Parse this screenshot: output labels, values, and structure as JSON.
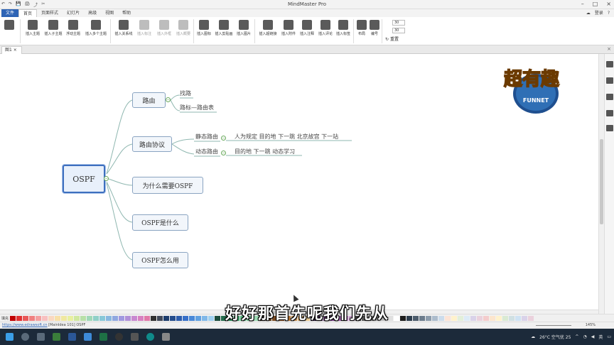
{
  "app": {
    "title": "MindMaster Pro",
    "quick_access": [
      "↶",
      "↷",
      "💾",
      "🖨",
      "⤴",
      "✂"
    ]
  },
  "menu": {
    "items": [
      "文件",
      "首页",
      "页面样式",
      "幻灯片",
      "高级",
      "视图",
      "帮助"
    ],
    "right": [
      "登录",
      "?"
    ]
  },
  "ribbon": {
    "buttons": [
      {
        "label": "插入主题",
        "disabled": false
      },
      {
        "label": "插入子主题",
        "disabled": false
      },
      {
        "label": "浮动主题",
        "disabled": false
      },
      {
        "label": "插入多个主题",
        "disabled": false
      },
      {
        "label": "插入关系线",
        "disabled": false
      },
      {
        "label": "插入标注",
        "disabled": true
      },
      {
        "label": "插入外框",
        "disabled": true
      },
      {
        "label": "插入概要",
        "disabled": true
      },
      {
        "label": "插入图标",
        "disabled": false
      },
      {
        "label": "插入剪贴画",
        "disabled": false
      },
      {
        "label": "插入图片",
        "disabled": false
      },
      {
        "label": "插入超链接",
        "disabled": false
      },
      {
        "label": "插入附件",
        "disabled": false
      },
      {
        "label": "插入注释",
        "disabled": false
      },
      {
        "label": "插入评论",
        "disabled": false
      },
      {
        "label": "插入标签",
        "disabled": false
      },
      {
        "label": "布局",
        "disabled": false
      },
      {
        "label": "编号",
        "disabled": false
      }
    ],
    "spin1": "30",
    "spin2": "30",
    "reset_label": "重置"
  },
  "tab": {
    "name": "图1"
  },
  "mindmap": {
    "root": "OSPF",
    "branches": [
      {
        "label": "路由",
        "children": [
          "找路",
          "路标—路由表"
        ]
      },
      {
        "label": "路由协议",
        "children": [
          {
            "label": "静态路由",
            "children": [
              "人为规定  目的地  下一跳   北京故宫  下一站"
            ]
          },
          {
            "label": "动态路由",
            "children": [
              "目的地  下一跳  动态学习"
            ]
          }
        ]
      },
      {
        "label": "为什么需要OSPF"
      },
      {
        "label": "OSPF是什么"
      },
      {
        "label": "OSPF怎么用"
      }
    ]
  },
  "logo": {
    "main": "超有趣",
    "sub": "FUNNET"
  },
  "palette": {
    "label": "填充",
    "colors": [
      "#c00000",
      "#e03030",
      "#e85858",
      "#f08080",
      "#f4a0a0",
      "#f8c0c0",
      "#fad8c0",
      "#f8e0a8",
      "#f0e8a0",
      "#e8f0a0",
      "#d0e8a0",
      "#b8e0a8",
      "#a0d8b8",
      "#90d0c8",
      "#88c8d8",
      "#88b8e0",
      "#90a8e0",
      "#a098e0",
      "#b090d8",
      "#c888d0",
      "#d880c0",
      "#e078a8",
      "#303030",
      "#404858",
      "#1c3c6c",
      "#244c8c",
      "#2c5cac",
      "#3870c8",
      "#4888d8",
      "#60a0e0",
      "#80b8e8",
      "#a0d0f0",
      "#1c4c3c",
      "#246c4c",
      "#2c8c5c",
      "#40a870",
      "#60c088",
      "#80d0a0",
      "#a0e0b8",
      "#3c2c1c",
      "#5c3c1c",
      "#7c4c24",
      "#9c5c2c",
      "#bc7c3c",
      "#d09858",
      "#e0b478",
      "#f0d098",
      "#2c1c3c",
      "#4c2c5c",
      "#6c3c7c",
      "#8c4c9c",
      "#ac68b8",
      "#c488cc",
      "#d8a8dc",
      "#404040",
      "#606060",
      "#808080",
      "#a0a0a0",
      "#c0c0c0",
      "#e0e0e0",
      "#ffffff",
      "#1c1c1c",
      "#2c3c4c",
      "#4c5c6c",
      "#6c7c8c",
      "#8c9cac",
      "#acbccc",
      "#ccdcec",
      "#fce4d6",
      "#fff2cc",
      "#e2efda",
      "#ddebf7",
      "#d9d2e9",
      "#ead1dc",
      "#f4cccc",
      "#fce5cd",
      "#fff2cc",
      "#d9ead3",
      "#d0e0e3",
      "#cfe2f3",
      "#d9d2e9",
      "#ead1dc"
    ]
  },
  "status": {
    "url": "https://www.edrawsoft.cn",
    "info": "[MainIdea 101]  OSPF",
    "zoom": "145%"
  },
  "taskbar": {
    "weather": "26°C 空气优 25",
    "ime": "英"
  },
  "subtitle": "好好那首先呢我们先从"
}
